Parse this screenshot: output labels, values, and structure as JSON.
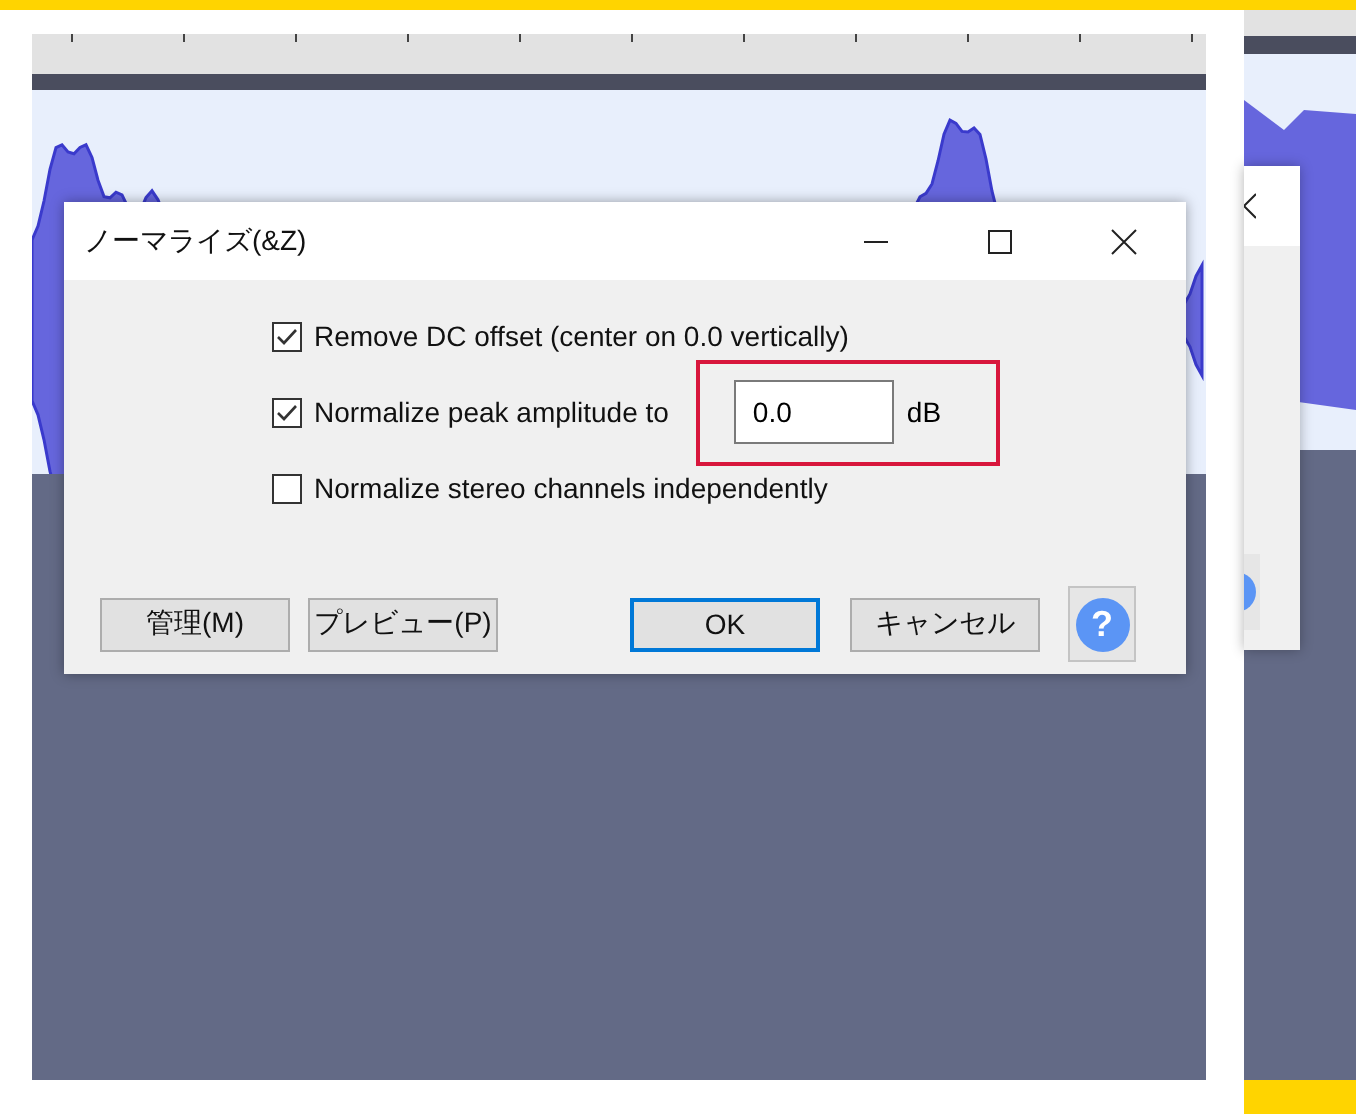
{
  "dialog": {
    "title": "ノーマライズ(&Z)",
    "options": [
      {
        "kind": "check",
        "label": "Remove DC offset (center on 0.0 vertically)",
        "checked": true
      },
      {
        "kind": "check_with_value",
        "label": "Normalize peak amplitude to",
        "checked": true,
        "value": "0.0",
        "unit": "dB"
      },
      {
        "kind": "check",
        "label": "Normalize stereo channels independently",
        "checked": false
      }
    ],
    "buttons": [
      {
        "label": "管理(M)",
        "default": false
      },
      {
        "label": "プレビュー(P)",
        "default": false
      },
      {
        "label": "OK",
        "default": true
      },
      {
        "label": "キャンセル",
        "default": false
      }
    ],
    "help": "?"
  }
}
